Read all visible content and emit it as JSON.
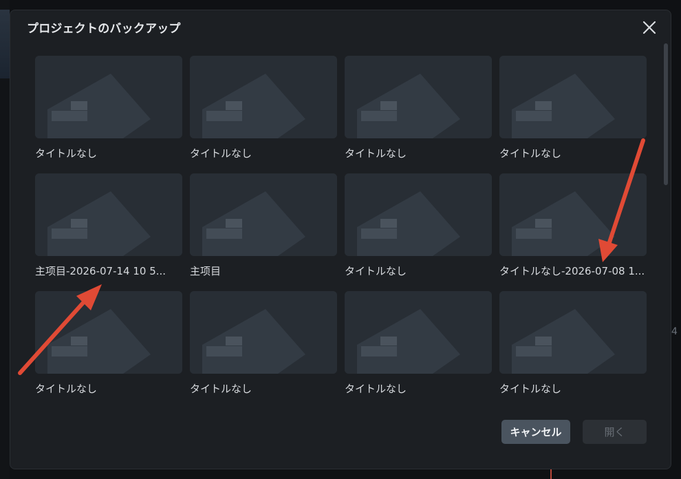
{
  "dialog": {
    "title": "プロジェクトのバックアップ",
    "close_icon": "close-icon"
  },
  "projects": [
    {
      "label": "タイトルなし"
    },
    {
      "label": "タイトルなし"
    },
    {
      "label": "タイトルなし"
    },
    {
      "label": "タイトルなし"
    },
    {
      "label": "主项目-2026-07-14 10 5..."
    },
    {
      "label": "主项目"
    },
    {
      "label": "タイトルなし"
    },
    {
      "label": "タイトルなし-2026-07-08 1..."
    },
    {
      "label": "タイトルなし"
    },
    {
      "label": "タイトルなし"
    },
    {
      "label": "タイトルなし"
    },
    {
      "label": "タイトルなし"
    }
  ],
  "buttons": {
    "cancel": "キャンセル",
    "open": "開く"
  },
  "background": {
    "digit": "4"
  },
  "colors": {
    "dialog_bg": "#1c1f23",
    "thumb_bg": "#2a3037",
    "cancel_bg": "#4a545f",
    "open_bg_disabled": "#2c3035",
    "annotation_arrow": "#e04a35"
  }
}
